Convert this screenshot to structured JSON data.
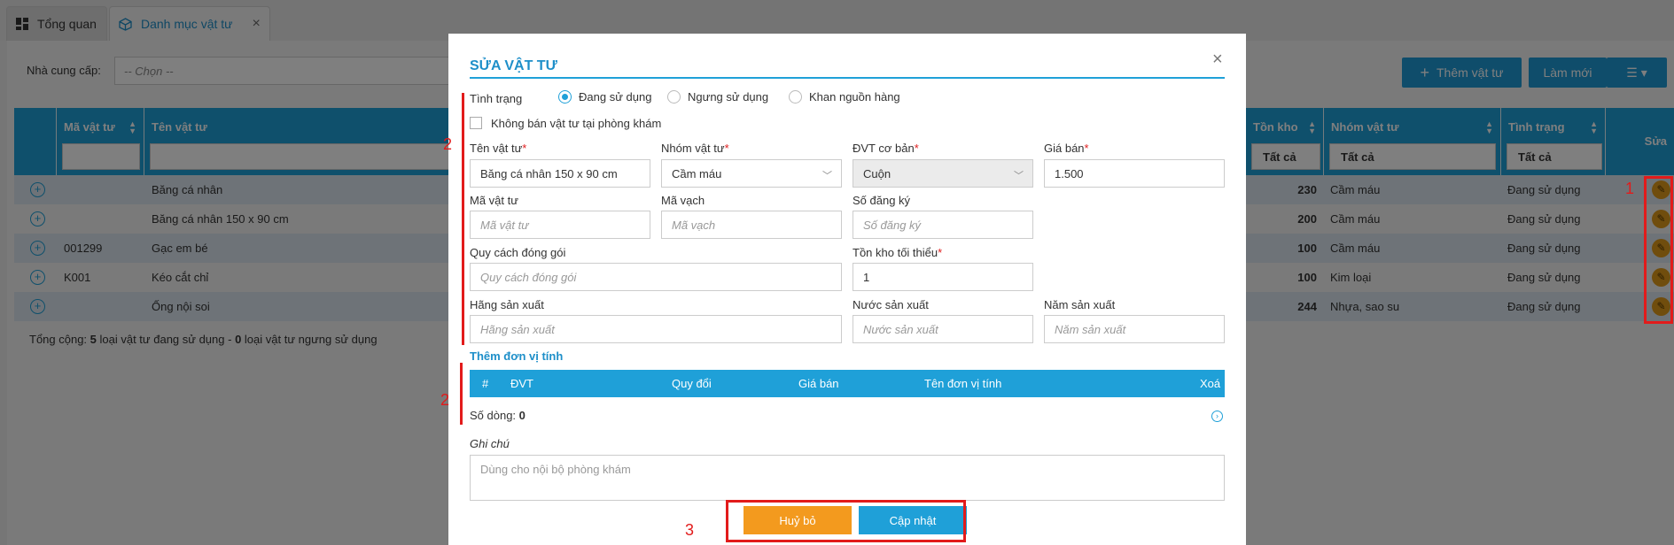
{
  "tabs": [
    {
      "label": "Tổng quan"
    },
    {
      "label": "Danh mục vật tư"
    }
  ],
  "filter": {
    "supplier_label": "Nhà cung cấp:",
    "supplier_placeholder": "-- Chọn --"
  },
  "toolbar": {
    "add_label": "Thêm vật tư",
    "refresh_label": "Làm mới"
  },
  "grid": {
    "columns": {
      "code": "Mã vật tư",
      "name": "Tên vật tư",
      "stock": "Tồn kho",
      "group": "Nhóm vật tư",
      "status": "Tình trạng",
      "edit": "Sửa"
    },
    "filter_all": "Tất cả",
    "rows": [
      {
        "code": "",
        "name": "Băng cá nhân",
        "stock": "230",
        "group": "Cầm máu",
        "status": "Đang sử dụng"
      },
      {
        "code": "",
        "name": "Băng cá nhân 150 x 90 cm",
        "stock": "200",
        "group": "Cầm máu",
        "status": "Đang sử dụng"
      },
      {
        "code": "001299",
        "name": "Gạc em bé",
        "stock": "100",
        "group": "Cầm máu",
        "status": "Đang sử dụng"
      },
      {
        "code": "K001",
        "name": "Kéo cắt chỉ",
        "stock": "100",
        "group": "Kim loại",
        "status": "Đang sử dụng"
      },
      {
        "code": "",
        "name": "Ống nội soi",
        "stock": "244",
        "group": "Nhựa, sao su",
        "status": "Đang sử dụng"
      }
    ],
    "summary": {
      "prefix": "Tổng cộng: ",
      "active_count": "5",
      "mid": " loại vật tư đang sử dụng - ",
      "inactive_count": "0",
      "suffix": " loại vật tư ngưng sử dụng"
    }
  },
  "modal": {
    "title": "SỬA VẬT TƯ",
    "status_label": "Tình trạng",
    "status_options": [
      "Đang sử dụng",
      "Ngưng sử dụng",
      "Khan nguồn hàng"
    ],
    "not_for_sale_label": "Không bán vật tư tại phòng khám",
    "name_label": "Tên vật tư",
    "name_value": "Băng cá nhân 150 x 90 cm",
    "group_label": "Nhóm vật tư",
    "group_value": "Cầm máu",
    "unit_label": "ĐVT cơ bản",
    "unit_value": "Cuộn",
    "price_label": "Giá bán",
    "price_value": "1.500",
    "code_label": "Mã vật tư",
    "code_placeholder": "Mã vật tư",
    "barcode_label": "Mã vạch",
    "barcode_placeholder": "Mã vạch",
    "reg_label": "Số đăng ký",
    "reg_placeholder": "Số đăng ký",
    "pack_label": "Quy cách đóng gói",
    "pack_placeholder": "Quy cách đóng gói",
    "minstock_label": "Tồn kho tối thiểu",
    "minstock_value": "1",
    "maker_label": "Hãng sản xuất",
    "maker_placeholder": "Hãng sản xuất",
    "country_label": "Nước sản xuất",
    "country_placeholder": "Nước sản xuất",
    "year_label": "Năm sản xuất",
    "year_placeholder": "Năm sản xuất",
    "add_unit_label": "Thêm đơn vị tính",
    "unit_columns": {
      "idx": "#",
      "unit": "ĐVT",
      "convert": "Quy đổi",
      "price": "Giá bán",
      "name": "Tên đơn vị tính",
      "delete": "Xoá"
    },
    "row_count_label": "Số dòng:",
    "row_count": "0",
    "note_label": "Ghi chú",
    "note_placeholder": "Dùng cho nội bộ phòng khám",
    "cancel_label": "Huỷ bỏ",
    "update_label": "Cập nhật"
  },
  "annotations": [
    "1",
    "2",
    "2",
    "3"
  ],
  "colors": {
    "primary": "#1fa0d8",
    "cancel": "#f39a1e",
    "annotation": "#e21b1b"
  }
}
